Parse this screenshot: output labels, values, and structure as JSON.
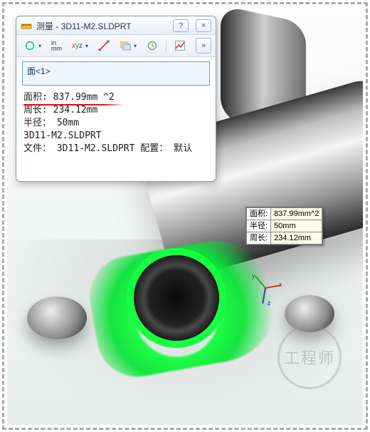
{
  "window": {
    "title": "测量 - 3D11-M2.SLDPRT",
    "help_tooltip": "?",
    "close_tooltip": "×"
  },
  "toolbar": {
    "sensor_label": "♂",
    "units_label": "in\nmm",
    "xyz_label": "xyz",
    "point_label": "•",
    "doc_label": "",
    "history_label": "",
    "graph_label": "",
    "pin_label": "»"
  },
  "selection": {
    "value": "面<1>"
  },
  "results": {
    "area_label": "面积:",
    "area_value": "837.99mm ^2",
    "perimeter_label": "周长:",
    "perimeter_value": "234.12mm",
    "radius_label": "半径：",
    "radius_value": "50mm",
    "part_name": "3D11-M2.SLDPRT",
    "file_label": "文件：",
    "file_value": "3D11-M2.SLDPRT",
    "config_label": "配置：",
    "config_value": "默认"
  },
  "flyout": {
    "rows": [
      {
        "k": "面积:",
        "v": "837.99mm^2"
      },
      {
        "k": "半径:",
        "v": "50mm"
      },
      {
        "k": "周长:",
        "v": "234.12mm"
      }
    ]
  },
  "watermark": "工程师",
  "colors": {
    "highlight": "#15ff3e",
    "annotation": "#d11",
    "dialog_border": "#8a9db5"
  }
}
